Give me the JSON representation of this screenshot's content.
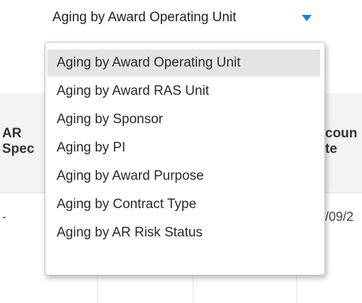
{
  "filter": {
    "selected_value": "Aging by Award Operating Unit",
    "options": [
      "Aging by Award Operating Unit",
      "Aging by Award RAS Unit",
      "Aging by Sponsor",
      "Aging by PI",
      "Aging by Award Purpose",
      "Aging by Contract Type",
      "Aging by AR Risk Status"
    ],
    "highlighted_index": 0,
    "accent_color": "#1f7ed0"
  },
  "table": {
    "col_ar_specialist": "AR\nSpec",
    "col_account_date": "coun\nte",
    "row1_specialist": "-",
    "row1_date": "/09/2"
  }
}
